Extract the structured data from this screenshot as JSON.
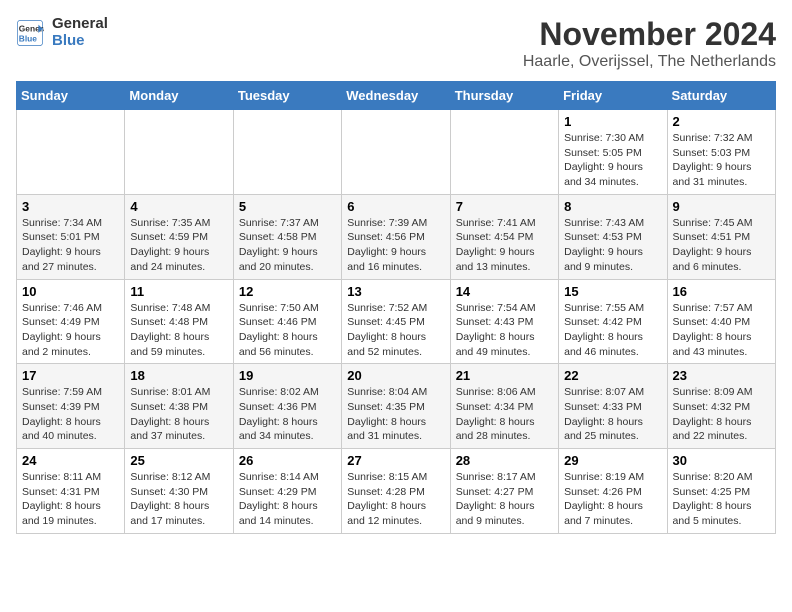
{
  "logo": {
    "line1": "General",
    "line2": "Blue"
  },
  "title": "November 2024",
  "subtitle": "Haarle, Overijssel, The Netherlands",
  "days_of_week": [
    "Sunday",
    "Monday",
    "Tuesday",
    "Wednesday",
    "Thursday",
    "Friday",
    "Saturday"
  ],
  "weeks": [
    [
      {
        "day": "",
        "info": ""
      },
      {
        "day": "",
        "info": ""
      },
      {
        "day": "",
        "info": ""
      },
      {
        "day": "",
        "info": ""
      },
      {
        "day": "",
        "info": ""
      },
      {
        "day": "1",
        "info": "Sunrise: 7:30 AM\nSunset: 5:05 PM\nDaylight: 9 hours and 34 minutes."
      },
      {
        "day": "2",
        "info": "Sunrise: 7:32 AM\nSunset: 5:03 PM\nDaylight: 9 hours and 31 minutes."
      }
    ],
    [
      {
        "day": "3",
        "info": "Sunrise: 7:34 AM\nSunset: 5:01 PM\nDaylight: 9 hours and 27 minutes."
      },
      {
        "day": "4",
        "info": "Sunrise: 7:35 AM\nSunset: 4:59 PM\nDaylight: 9 hours and 24 minutes."
      },
      {
        "day": "5",
        "info": "Sunrise: 7:37 AM\nSunset: 4:58 PM\nDaylight: 9 hours and 20 minutes."
      },
      {
        "day": "6",
        "info": "Sunrise: 7:39 AM\nSunset: 4:56 PM\nDaylight: 9 hours and 16 minutes."
      },
      {
        "day": "7",
        "info": "Sunrise: 7:41 AM\nSunset: 4:54 PM\nDaylight: 9 hours and 13 minutes."
      },
      {
        "day": "8",
        "info": "Sunrise: 7:43 AM\nSunset: 4:53 PM\nDaylight: 9 hours and 9 minutes."
      },
      {
        "day": "9",
        "info": "Sunrise: 7:45 AM\nSunset: 4:51 PM\nDaylight: 9 hours and 6 minutes."
      }
    ],
    [
      {
        "day": "10",
        "info": "Sunrise: 7:46 AM\nSunset: 4:49 PM\nDaylight: 9 hours and 2 minutes."
      },
      {
        "day": "11",
        "info": "Sunrise: 7:48 AM\nSunset: 4:48 PM\nDaylight: 8 hours and 59 minutes."
      },
      {
        "day": "12",
        "info": "Sunrise: 7:50 AM\nSunset: 4:46 PM\nDaylight: 8 hours and 56 minutes."
      },
      {
        "day": "13",
        "info": "Sunrise: 7:52 AM\nSunset: 4:45 PM\nDaylight: 8 hours and 52 minutes."
      },
      {
        "day": "14",
        "info": "Sunrise: 7:54 AM\nSunset: 4:43 PM\nDaylight: 8 hours and 49 minutes."
      },
      {
        "day": "15",
        "info": "Sunrise: 7:55 AM\nSunset: 4:42 PM\nDaylight: 8 hours and 46 minutes."
      },
      {
        "day": "16",
        "info": "Sunrise: 7:57 AM\nSunset: 4:40 PM\nDaylight: 8 hours and 43 minutes."
      }
    ],
    [
      {
        "day": "17",
        "info": "Sunrise: 7:59 AM\nSunset: 4:39 PM\nDaylight: 8 hours and 40 minutes."
      },
      {
        "day": "18",
        "info": "Sunrise: 8:01 AM\nSunset: 4:38 PM\nDaylight: 8 hours and 37 minutes."
      },
      {
        "day": "19",
        "info": "Sunrise: 8:02 AM\nSunset: 4:36 PM\nDaylight: 8 hours and 34 minutes."
      },
      {
        "day": "20",
        "info": "Sunrise: 8:04 AM\nSunset: 4:35 PM\nDaylight: 8 hours and 31 minutes."
      },
      {
        "day": "21",
        "info": "Sunrise: 8:06 AM\nSunset: 4:34 PM\nDaylight: 8 hours and 28 minutes."
      },
      {
        "day": "22",
        "info": "Sunrise: 8:07 AM\nSunset: 4:33 PM\nDaylight: 8 hours and 25 minutes."
      },
      {
        "day": "23",
        "info": "Sunrise: 8:09 AM\nSunset: 4:32 PM\nDaylight: 8 hours and 22 minutes."
      }
    ],
    [
      {
        "day": "24",
        "info": "Sunrise: 8:11 AM\nSunset: 4:31 PM\nDaylight: 8 hours and 19 minutes."
      },
      {
        "day": "25",
        "info": "Sunrise: 8:12 AM\nSunset: 4:30 PM\nDaylight: 8 hours and 17 minutes."
      },
      {
        "day": "26",
        "info": "Sunrise: 8:14 AM\nSunset: 4:29 PM\nDaylight: 8 hours and 14 minutes."
      },
      {
        "day": "27",
        "info": "Sunrise: 8:15 AM\nSunset: 4:28 PM\nDaylight: 8 hours and 12 minutes."
      },
      {
        "day": "28",
        "info": "Sunrise: 8:17 AM\nSunset: 4:27 PM\nDaylight: 8 hours and 9 minutes."
      },
      {
        "day": "29",
        "info": "Sunrise: 8:19 AM\nSunset: 4:26 PM\nDaylight: 8 hours and 7 minutes."
      },
      {
        "day": "30",
        "info": "Sunrise: 8:20 AM\nSunset: 4:25 PM\nDaylight: 8 hours and 5 minutes."
      }
    ]
  ]
}
